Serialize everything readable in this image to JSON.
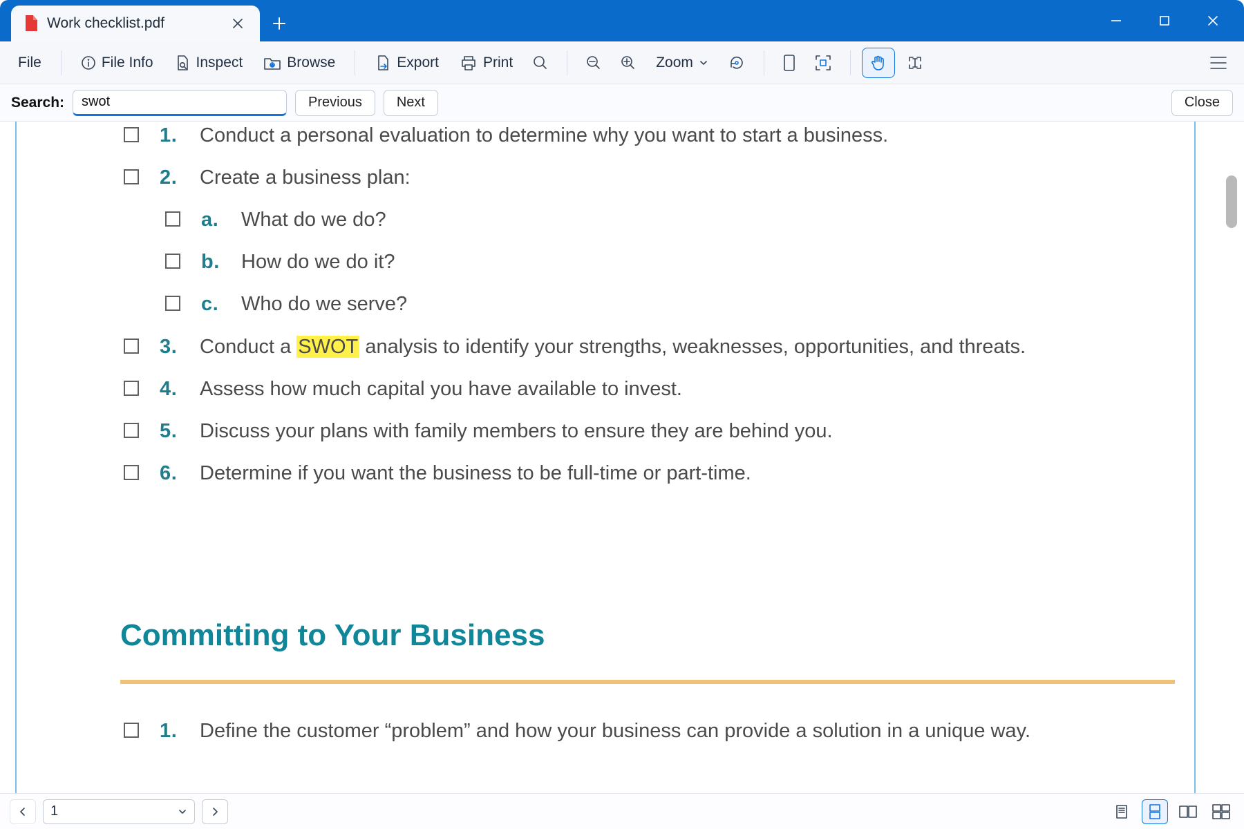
{
  "window": {
    "tab_title": "Work checklist.pdf"
  },
  "toolbar": {
    "file": "File",
    "file_info": "File Info",
    "inspect": "Inspect",
    "browse": "Browse",
    "export": "Export",
    "print": "Print",
    "zoom": "Zoom"
  },
  "search": {
    "label": "Search:",
    "value": "swot",
    "previous": "Previous",
    "next": "Next",
    "close": "Close",
    "highlight_term": "SWOT"
  },
  "doc": {
    "items": [
      {
        "n": "1.",
        "t": "Conduct a personal evaluation to determine why you want to start a business."
      },
      {
        "n": "2.",
        "t": "Create a business plan:"
      }
    ],
    "subitems": [
      {
        "n": "a.",
        "t": "What do we do?"
      },
      {
        "n": "b.",
        "t": "How do we do it?"
      },
      {
        "n": "c.",
        "t": "Who do we serve?"
      }
    ],
    "item3_pre": "Conduct a ",
    "item3_mark": "SWOT",
    "item3_post": " analysis to identify your strengths, weaknesses, opportunities, and threats.",
    "item3_n": "3.",
    "items_after": [
      {
        "n": "4.",
        "t": "Assess how much capital you have available to invest."
      },
      {
        "n": "5.",
        "t": "Discuss your plans with family members to ensure they are behind you."
      },
      {
        "n": "6.",
        "t": "Determine if you want the business to be full-time or part-time."
      }
    ],
    "section2_title": "Committing to Your Business",
    "section2_item1_n": "1.",
    "section2_item1_t": "Define the customer “problem” and how your business can provide a solution in a unique way."
  },
  "status": {
    "page": "1"
  }
}
